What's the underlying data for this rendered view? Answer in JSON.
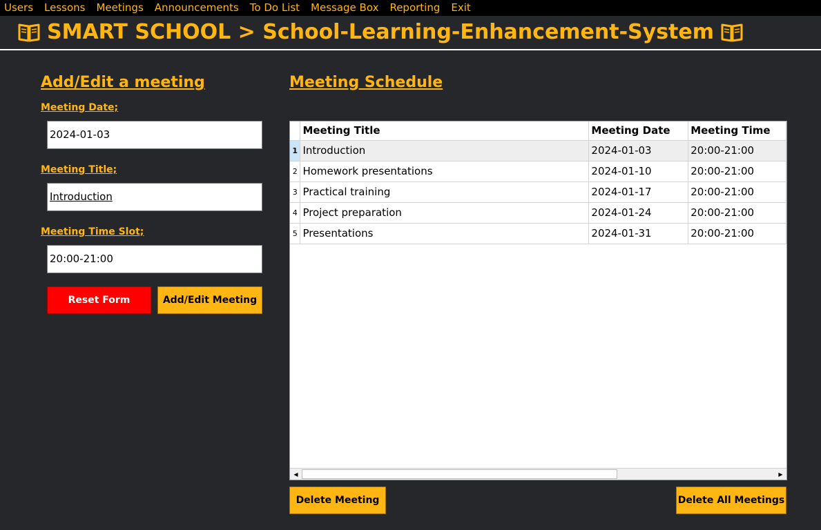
{
  "menu": [
    "Users",
    "Lessons",
    "Meetings",
    "Announcements",
    "To Do List",
    "Message Box",
    "Reporting",
    "Exit"
  ],
  "header": {
    "title": "SMART SCHOOL > School-Learning-Enhancement-System"
  },
  "form": {
    "heading": "Add/Edit a meeting",
    "date_label": "Meeting Date;",
    "date_value": "2024-01-03",
    "title_label": "Meeting Title;",
    "title_value": "Introduction",
    "time_label": "Meeting Time Slot;",
    "time_value": "20:00-21:00",
    "reset_label": "Reset Form",
    "submit_label": "Add/Edit Meeting"
  },
  "schedule": {
    "heading": "Meeting Schedule",
    "columns": [
      "Meeting Title",
      "Meeting Date",
      "Meeting Time"
    ],
    "rows": [
      {
        "num": "1",
        "title": "Introduction",
        "date": "2024-01-03",
        "time": "20:00-21:00"
      },
      {
        "num": "2",
        "title": "Homework presentations",
        "date": "2024-01-10",
        "time": "20:00-21:00"
      },
      {
        "num": "3",
        "title": "Practical training",
        "date": "2024-01-17",
        "time": "20:00-21:00"
      },
      {
        "num": "4",
        "title": "Project preparation",
        "date": "2024-01-24",
        "time": "20:00-21:00"
      },
      {
        "num": "5",
        "title": "Presentations",
        "date": "2024-01-31",
        "time": "20:00-21:00"
      }
    ],
    "delete_label": "Delete Meeting",
    "delete_all_label": "Delete All Meetings"
  },
  "colors": {
    "accent": "#ffb612",
    "background": "#26272b",
    "menubar": "#000000",
    "reset_button": "#ff0000"
  },
  "icons": {
    "header_left": "book-icon",
    "header_right": "book-icon"
  }
}
